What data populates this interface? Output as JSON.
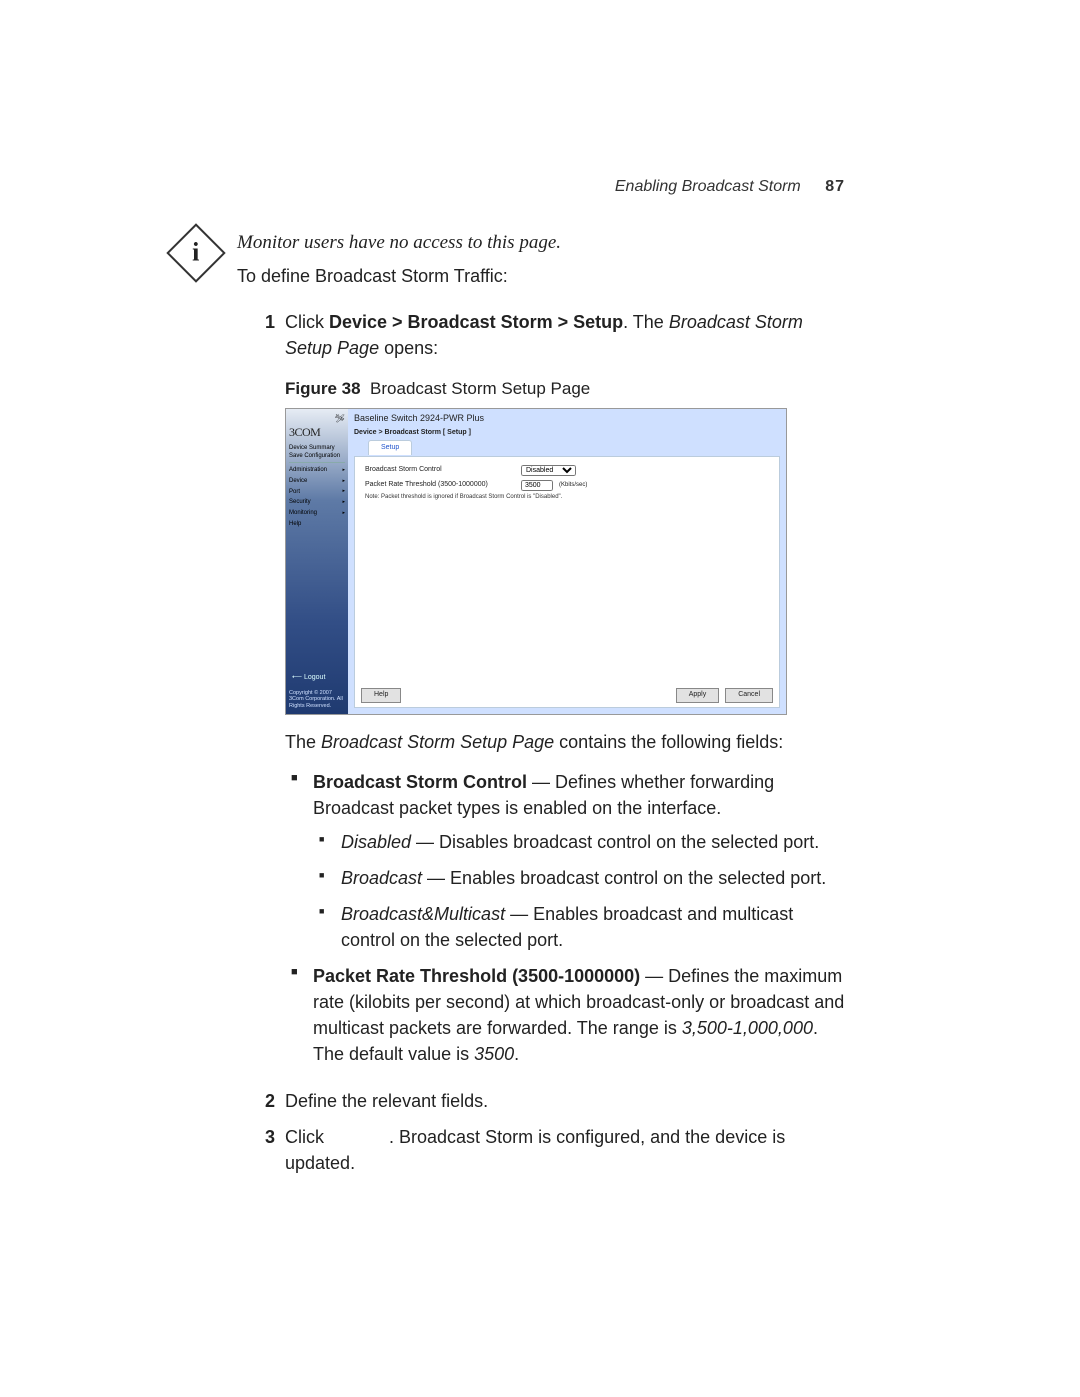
{
  "header": {
    "section": "Enabling Broadcast Storm",
    "page_number": "87"
  },
  "note": "Monitor users have no access to this page.",
  "intro": "To define Broadcast Storm Traffic:",
  "step1": {
    "num": "1",
    "prefix": "Click ",
    "path": "Device > Broadcast Storm > Setup",
    "mid": ". The ",
    "page_ref": "Broadcast Storm Setup Page",
    "suffix": " opens:"
  },
  "figure": {
    "label": "Figure 38",
    "caption": "Broadcast Storm Setup Page"
  },
  "mock": {
    "logo": "3COM",
    "title": "Baseline Switch 2924-PWR Plus",
    "crumb": "Device > Broadcast Storm [ Setup ]",
    "tab": "Setup",
    "sidebar": {
      "summary": "Device Summary",
      "save": "Save Configuration",
      "items": [
        "Administration",
        "Device",
        "Port",
        "Security",
        "Monitoring",
        "Help"
      ]
    },
    "form": {
      "control_label": "Broadcast Storm Control",
      "control_value": "Disabled",
      "thr_label": "Packet Rate Threshold (3500-1000000)",
      "thr_value": "3500",
      "thr_unit": "(Kbits/sec)",
      "note": "Note: Packet threshold is ignored if Broadcast Storm Control is \"Disabled\"."
    },
    "buttons": {
      "help": "Help",
      "apply": "Apply",
      "cancel": "Cancel"
    },
    "logout": "Logout",
    "copyright": "Copyright © 2007 3Com Corporation. All Rights Reserved."
  },
  "after_fig": {
    "lead_pre": "The ",
    "lead_ital": "Broadcast Storm Setup Page",
    "lead_post": " contains the following fields:"
  },
  "field_bsc": {
    "name": "Broadcast Storm Control",
    "desc": " — Defines whether forwarding Broadcast packet types is enabled on the interface.",
    "opts": {
      "disabled": {
        "name": "Disabled",
        "desc": " — Disables broadcast control on the selected port."
      },
      "broadcast": {
        "name": "Broadcast",
        "desc": " — Enables broadcast control on the selected port."
      },
      "bm": {
        "name": "Broadcast&Multicast",
        "desc": " — Enables broadcast and multicast control on the selected port."
      }
    }
  },
  "field_thr": {
    "name": "Packet Rate Threshold (3500-1000000)",
    "desc_a": " — Defines the maximum rate (kilobits per second) at which broadcast-only or broadcast and multicast packets are forwarded. The range is ",
    "range": "3,500-1,000,000",
    "desc_b": ". The default value is ",
    "default": "3500",
    "desc_c": "."
  },
  "step2": {
    "num": "2",
    "text": "Define the relevant fields."
  },
  "step3": {
    "num": "3",
    "pre": "Click ",
    "gap": "            ",
    "post": ". Broadcast Storm is configured, and the device is updated."
  }
}
